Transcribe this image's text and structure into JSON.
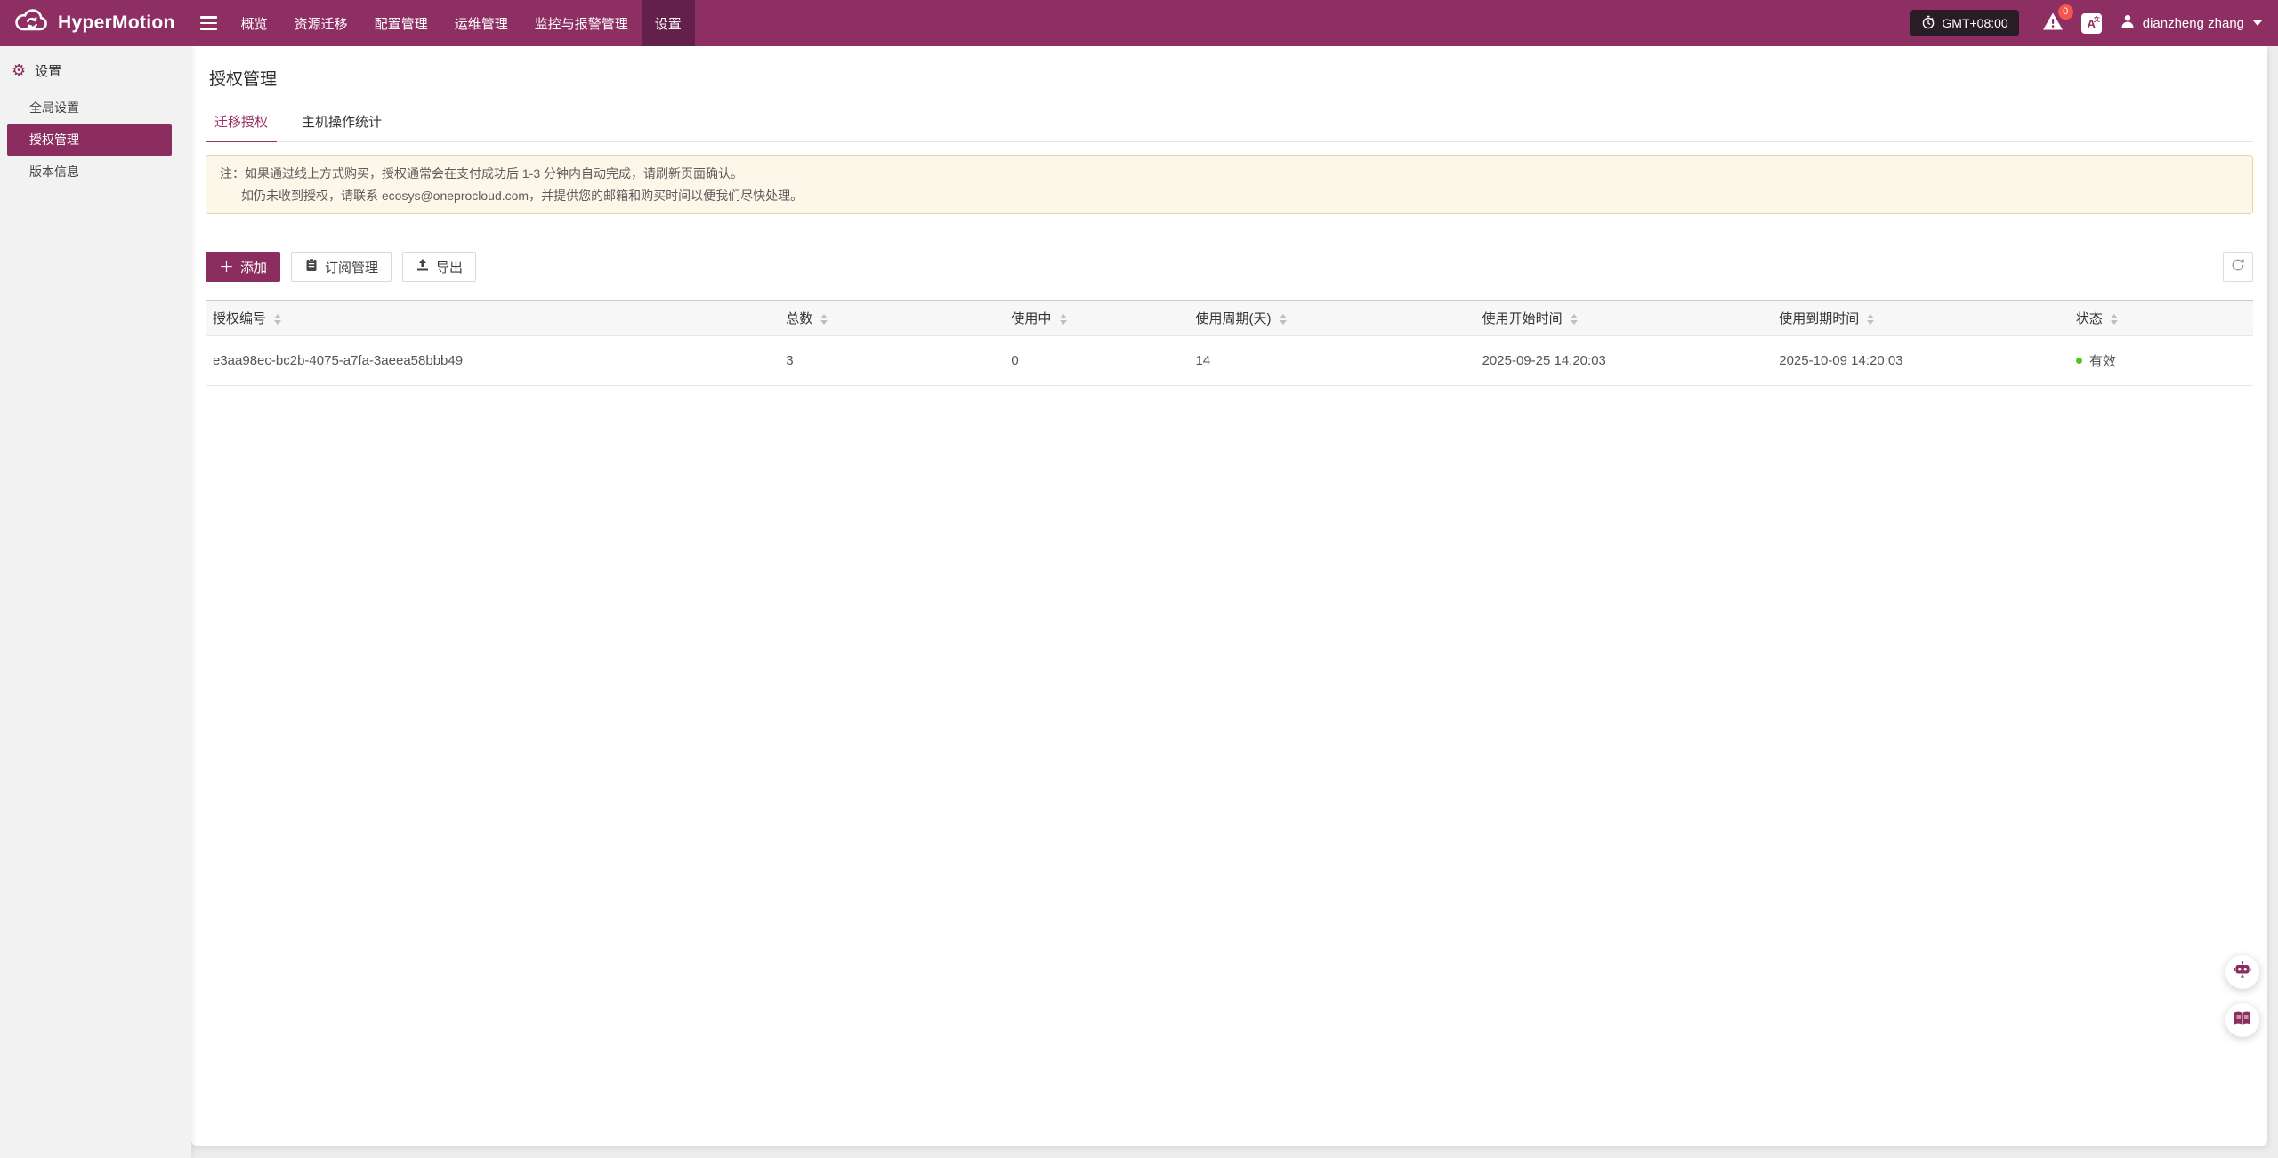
{
  "navbar": {
    "brand": "HyperMotion",
    "items": [
      {
        "label": "概览"
      },
      {
        "label": "资源迁移"
      },
      {
        "label": "配置管理"
      },
      {
        "label": "运维管理"
      },
      {
        "label": "监控与报警管理"
      },
      {
        "label": "设置"
      }
    ],
    "timezone": "GMT+08:00",
    "notification_count": "0",
    "language_glyph": "A",
    "language_glyph_small": "文",
    "user_name": "dianzheng zhang"
  },
  "sidebar": {
    "header": "设置",
    "gear_glyph": "⚙",
    "items": [
      {
        "label": "全局设置"
      },
      {
        "label": "授权管理"
      },
      {
        "label": "版本信息"
      }
    ]
  },
  "page": {
    "title": "授权管理",
    "tabs": [
      {
        "label": "迁移授权"
      },
      {
        "label": "主机操作统计"
      }
    ],
    "notice": {
      "line1": "注：如果通过线上方式购买，授权通常会在支付成功后 1-3 分钟内自动完成，请刷新页面确认。",
      "line2": "如仍未收到授权，请联系 ecosys@oneprocloud.com，并提供您的邮箱和购买时间以便我们尽快处理。"
    },
    "toolbar": {
      "add_label": "添加",
      "add_plus_glyph": "＋",
      "subscription_label": "订阅管理",
      "export_label": "导出"
    }
  },
  "table": {
    "columns": [
      "授权编号",
      "总数",
      "使用中",
      "使用周期(天)",
      "使用开始时间",
      "使用到期时间",
      "状态"
    ],
    "rows": [
      {
        "authorization_id": "e3aa98ec-bc2b-4075-a7fa-3aeea58bbb49",
        "total": "3",
        "in_use": "0",
        "usage_period_days": "14",
        "start_time": "2025-09-25 14:20:03",
        "expire_time": "2025-10-09 14:20:03",
        "status": "有效"
      }
    ]
  },
  "colors": {
    "brand": "#8E2F63",
    "nav_active_bg": "#63204A",
    "sidebar_active_bg": "#8B2D5F",
    "tab_active": "#9A3166",
    "notice_bg": "#FDF7EA",
    "notice_border": "#EDD3A2",
    "status_green": "#52C41A",
    "badge_red": "#F5554D",
    "gmt_badge_bg": "#2A1C24"
  }
}
